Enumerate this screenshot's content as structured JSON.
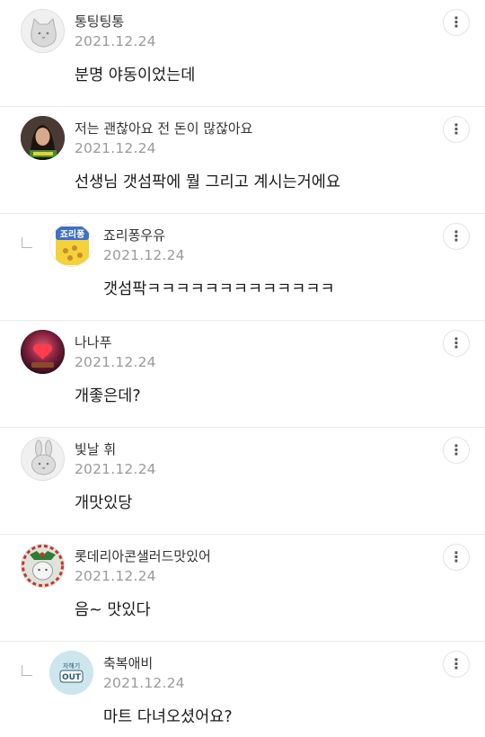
{
  "comments": [
    {
      "nickname": "통팅팅통",
      "date": "2021.12.24",
      "text": "분명 야동이었는데",
      "reply": false,
      "avatar": "gray-cat-icon"
    },
    {
      "nickname": "저는 괜찮아요 전 돈이 많잖아요",
      "date": "2021.12.24",
      "text": "선생님 갯섬팍에 뭘 그리고 계시는거에요",
      "reply": false,
      "avatar": "person-photo"
    },
    {
      "nickname": "죠리퐁우유",
      "date": "2021.12.24",
      "text": "갯섬팍ㅋㅋㅋㅋㅋㅋㅋㅋㅋㅋㅋㅋㅋ",
      "reply": true,
      "avatar": "snack-box-image",
      "avatar_label": "죠리퐁"
    },
    {
      "nickname": "나나푸",
      "date": "2021.12.24",
      "text": "개좋은데?",
      "reply": false,
      "avatar": "heart-orb-image"
    },
    {
      "nickname": "빛날 휘",
      "date": "2021.12.24",
      "text": "개맛있당",
      "reply": false,
      "avatar": "gray-rabbit-icon"
    },
    {
      "nickname": "롯데리아콘샐러드맛있어",
      "date": "2021.12.24",
      "text": "음~ 맛있다",
      "reply": false,
      "avatar": "christmas-cat-image"
    },
    {
      "nickname": "축복애비",
      "date": "2021.12.24",
      "text": "마트 다녀오셨어요?",
      "reply": true,
      "avatar": "out-badge-image",
      "avatar_label_top": "자해기",
      "avatar_label_main": "OUT"
    }
  ],
  "more_icon": "⋮",
  "colors": {
    "divider": "#ebebeb",
    "date": "#9a9a9a",
    "avatar_bg": "#f2f2f2"
  }
}
